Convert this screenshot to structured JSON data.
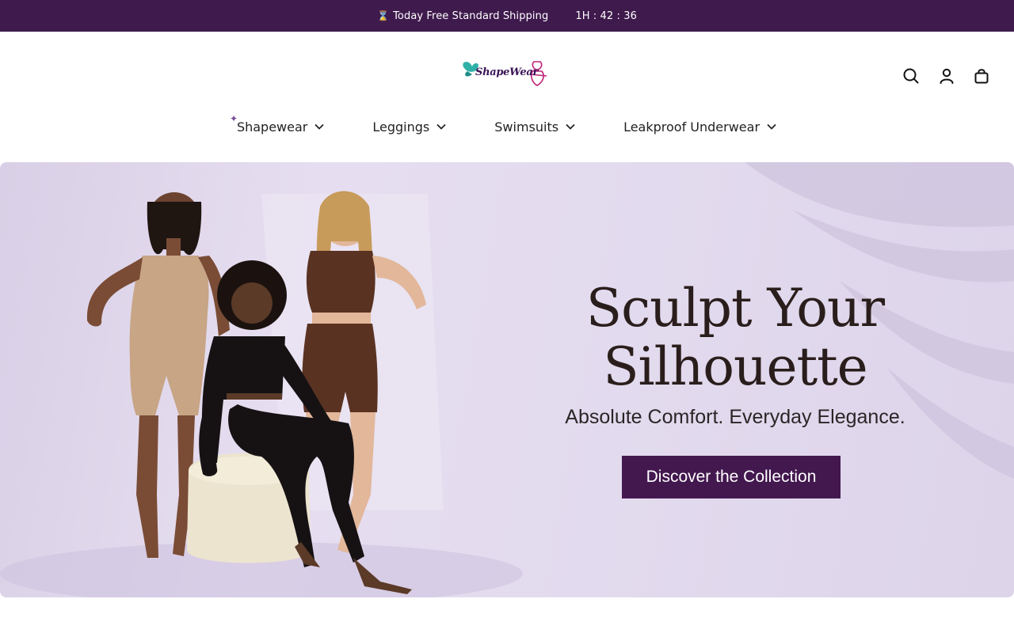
{
  "announcement": {
    "icon": "hourglass-icon",
    "text": "Today Free Standard Shipping",
    "timer": "1H : 42 : 36"
  },
  "header": {
    "logo_text": "ShapeWear",
    "icons": [
      "search-icon",
      "account-icon",
      "cart-icon"
    ]
  },
  "nav": {
    "items": [
      {
        "label": "Shapewear"
      },
      {
        "label": "Leggings"
      },
      {
        "label": "Swimsuits"
      },
      {
        "label": "Leakproof Underwear"
      }
    ]
  },
  "hero": {
    "title_line1": "Sculpt Your",
    "title_line2": "Silhouette",
    "subtitle": "Absolute Comfort. Everyday Elegance.",
    "cta_label": "Discover the Collection"
  },
  "colors": {
    "announcement_bg": "#3f1a4d",
    "cta_bg": "#43184f",
    "hero_bg": "#e3dbee"
  }
}
